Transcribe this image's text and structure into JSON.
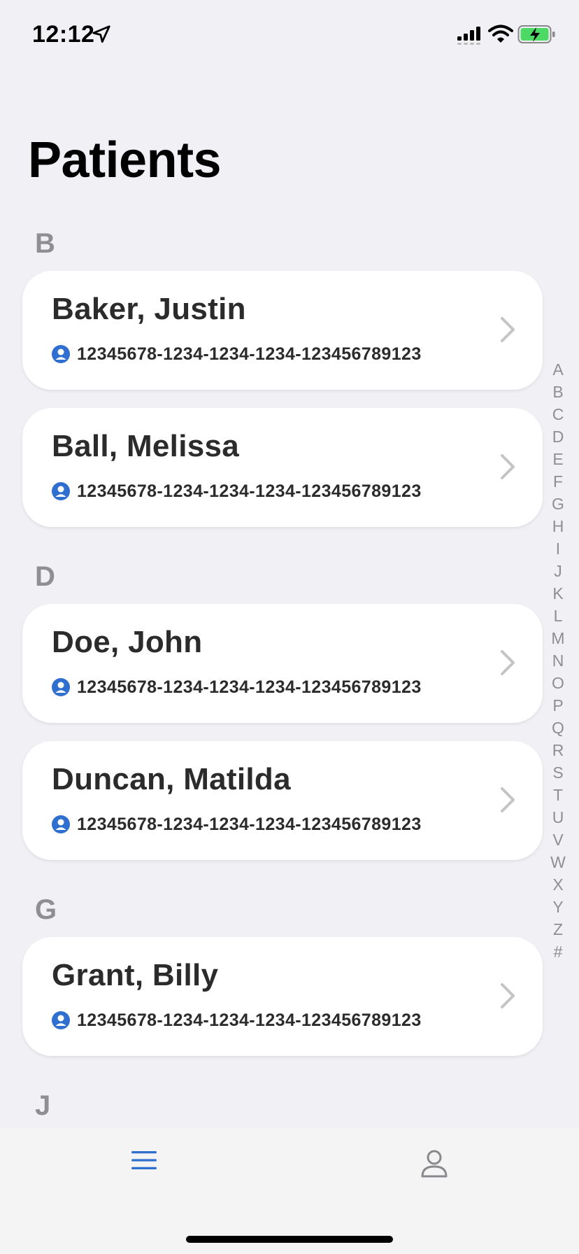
{
  "status_bar": {
    "time": "12:12"
  },
  "header": {
    "title": "Patients"
  },
  "sections": [
    {
      "letter": "B",
      "patients": [
        {
          "name": "Baker, Justin",
          "id": "12345678-1234-1234-1234-123456789123"
        },
        {
          "name": "Ball, Melissa",
          "id": "12345678-1234-1234-1234-123456789123"
        }
      ]
    },
    {
      "letter": "D",
      "patients": [
        {
          "name": "Doe, John",
          "id": "12345678-1234-1234-1234-123456789123"
        },
        {
          "name": "Duncan, Matilda",
          "id": "12345678-1234-1234-1234-123456789123"
        }
      ]
    },
    {
      "letter": "G",
      "patients": [
        {
          "name": "Grant, Billy",
          "id": "12345678-1234-1234-1234-123456789123"
        }
      ]
    },
    {
      "letter": "J",
      "patients": []
    }
  ],
  "alphabet_index": [
    "A",
    "B",
    "C",
    "D",
    "E",
    "F",
    "G",
    "H",
    "I",
    "J",
    "K",
    "L",
    "M",
    "N",
    "O",
    "P",
    "Q",
    "R",
    "S",
    "T",
    "U",
    "V",
    "W",
    "X",
    "Y",
    "Z",
    "#"
  ],
  "tab_bar": {
    "tabs": [
      {
        "icon": "menu-icon",
        "active": true
      },
      {
        "icon": "profile-icon",
        "active": false
      }
    ]
  },
  "colors": {
    "accent": "#2f6fd0",
    "background": "#f0f0f5",
    "card": "#ffffff",
    "section_letter": "#8e8e93",
    "battery": "#4cd964"
  }
}
